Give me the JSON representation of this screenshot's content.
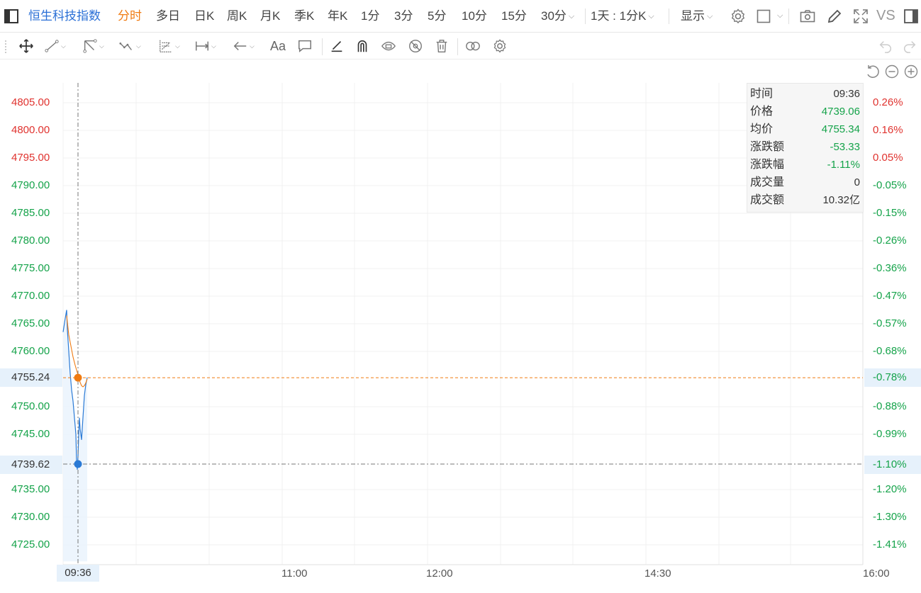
{
  "header": {
    "symbol": "恒生科技指数",
    "periods": [
      {
        "label": "分时",
        "active": true
      },
      {
        "label": "多日"
      },
      {
        "label": "日K"
      },
      {
        "label": "周K"
      },
      {
        "label": "月K"
      },
      {
        "label": "季K"
      },
      {
        "label": "年K"
      },
      {
        "label": "1分"
      },
      {
        "label": "3分"
      },
      {
        "label": "5分"
      },
      {
        "label": "10分"
      },
      {
        "label": "15分"
      }
    ],
    "period_dropdown": "30分",
    "range_dropdown": "1天 : 1分K",
    "display_dropdown": "显示",
    "vs_label": "VS"
  },
  "toolbar": {
    "text_tool": "Aa",
    "icons": [
      "move-icon",
      "trend-line-icon",
      "channel-icon",
      "wave-icon",
      "fib-icon",
      "measure-icon",
      "arrow-icon",
      "text-icon",
      "comment-icon",
      "pen-icon",
      "magnet-icon",
      "eye-lock-icon",
      "eye-hide-icon",
      "trash-icon",
      "link-icon",
      "settings-icon",
      "undo-icon",
      "redo-icon"
    ]
  },
  "chart": {
    "left_axis": [
      "4805.00",
      "4800.00",
      "4795.00",
      "4790.00",
      "4785.00",
      "4780.00",
      "4775.00",
      "4770.00",
      "4765.00",
      "4760.00",
      "4750.00",
      "4745.00",
      "4735.00",
      "4730.00",
      "4725.00"
    ],
    "left_axis_colors": [
      "up",
      "up",
      "up",
      "down",
      "down",
      "down",
      "down",
      "down",
      "down",
      "down",
      "down",
      "down",
      "down",
      "down",
      "down"
    ],
    "right_axis": [
      "0.26%",
      "0.16%",
      "0.05%",
      "-0.05%",
      "-0.15%",
      "-0.26%",
      "-0.36%",
      "-0.47%",
      "-0.57%",
      "-0.68%",
      "-0.88%",
      "-0.99%",
      "-1.20%",
      "-1.30%",
      "-1.41%"
    ],
    "right_axis_colors": [
      "up",
      "up",
      "up",
      "down",
      "down",
      "down",
      "down",
      "down",
      "down",
      "down",
      "down",
      "down",
      "down",
      "down",
      "down"
    ],
    "crosshair_price_avg": "4755.24",
    "crosshair_pct_avg": "-0.78%",
    "crosshair_price_cursor": "4739.62",
    "crosshair_pct_cursor": "-1.10%",
    "time_labels": [
      "11:00",
      "12:00",
      "14:30",
      "16:00"
    ],
    "time_cursor": "09:36",
    "colors": {
      "price_line": "#2a7ad6",
      "avg_line": "#f07b12",
      "up": "#e0332f",
      "down": "#15a34a"
    }
  },
  "info": {
    "rows": [
      {
        "k": "时间",
        "v": "09:36",
        "cls": ""
      },
      {
        "k": "价格",
        "v": "4739.06",
        "cls": "down"
      },
      {
        "k": "均价",
        "v": "4755.34",
        "cls": "down"
      },
      {
        "k": "涨跌额",
        "v": "-53.33",
        "cls": "down"
      },
      {
        "k": "涨跌幅",
        "v": "-1.11%",
        "cls": "down"
      },
      {
        "k": "成交量",
        "v": "0",
        "cls": ""
      },
      {
        "k": "成交额",
        "v": "10.32亿",
        "cls": ""
      }
    ]
  }
}
